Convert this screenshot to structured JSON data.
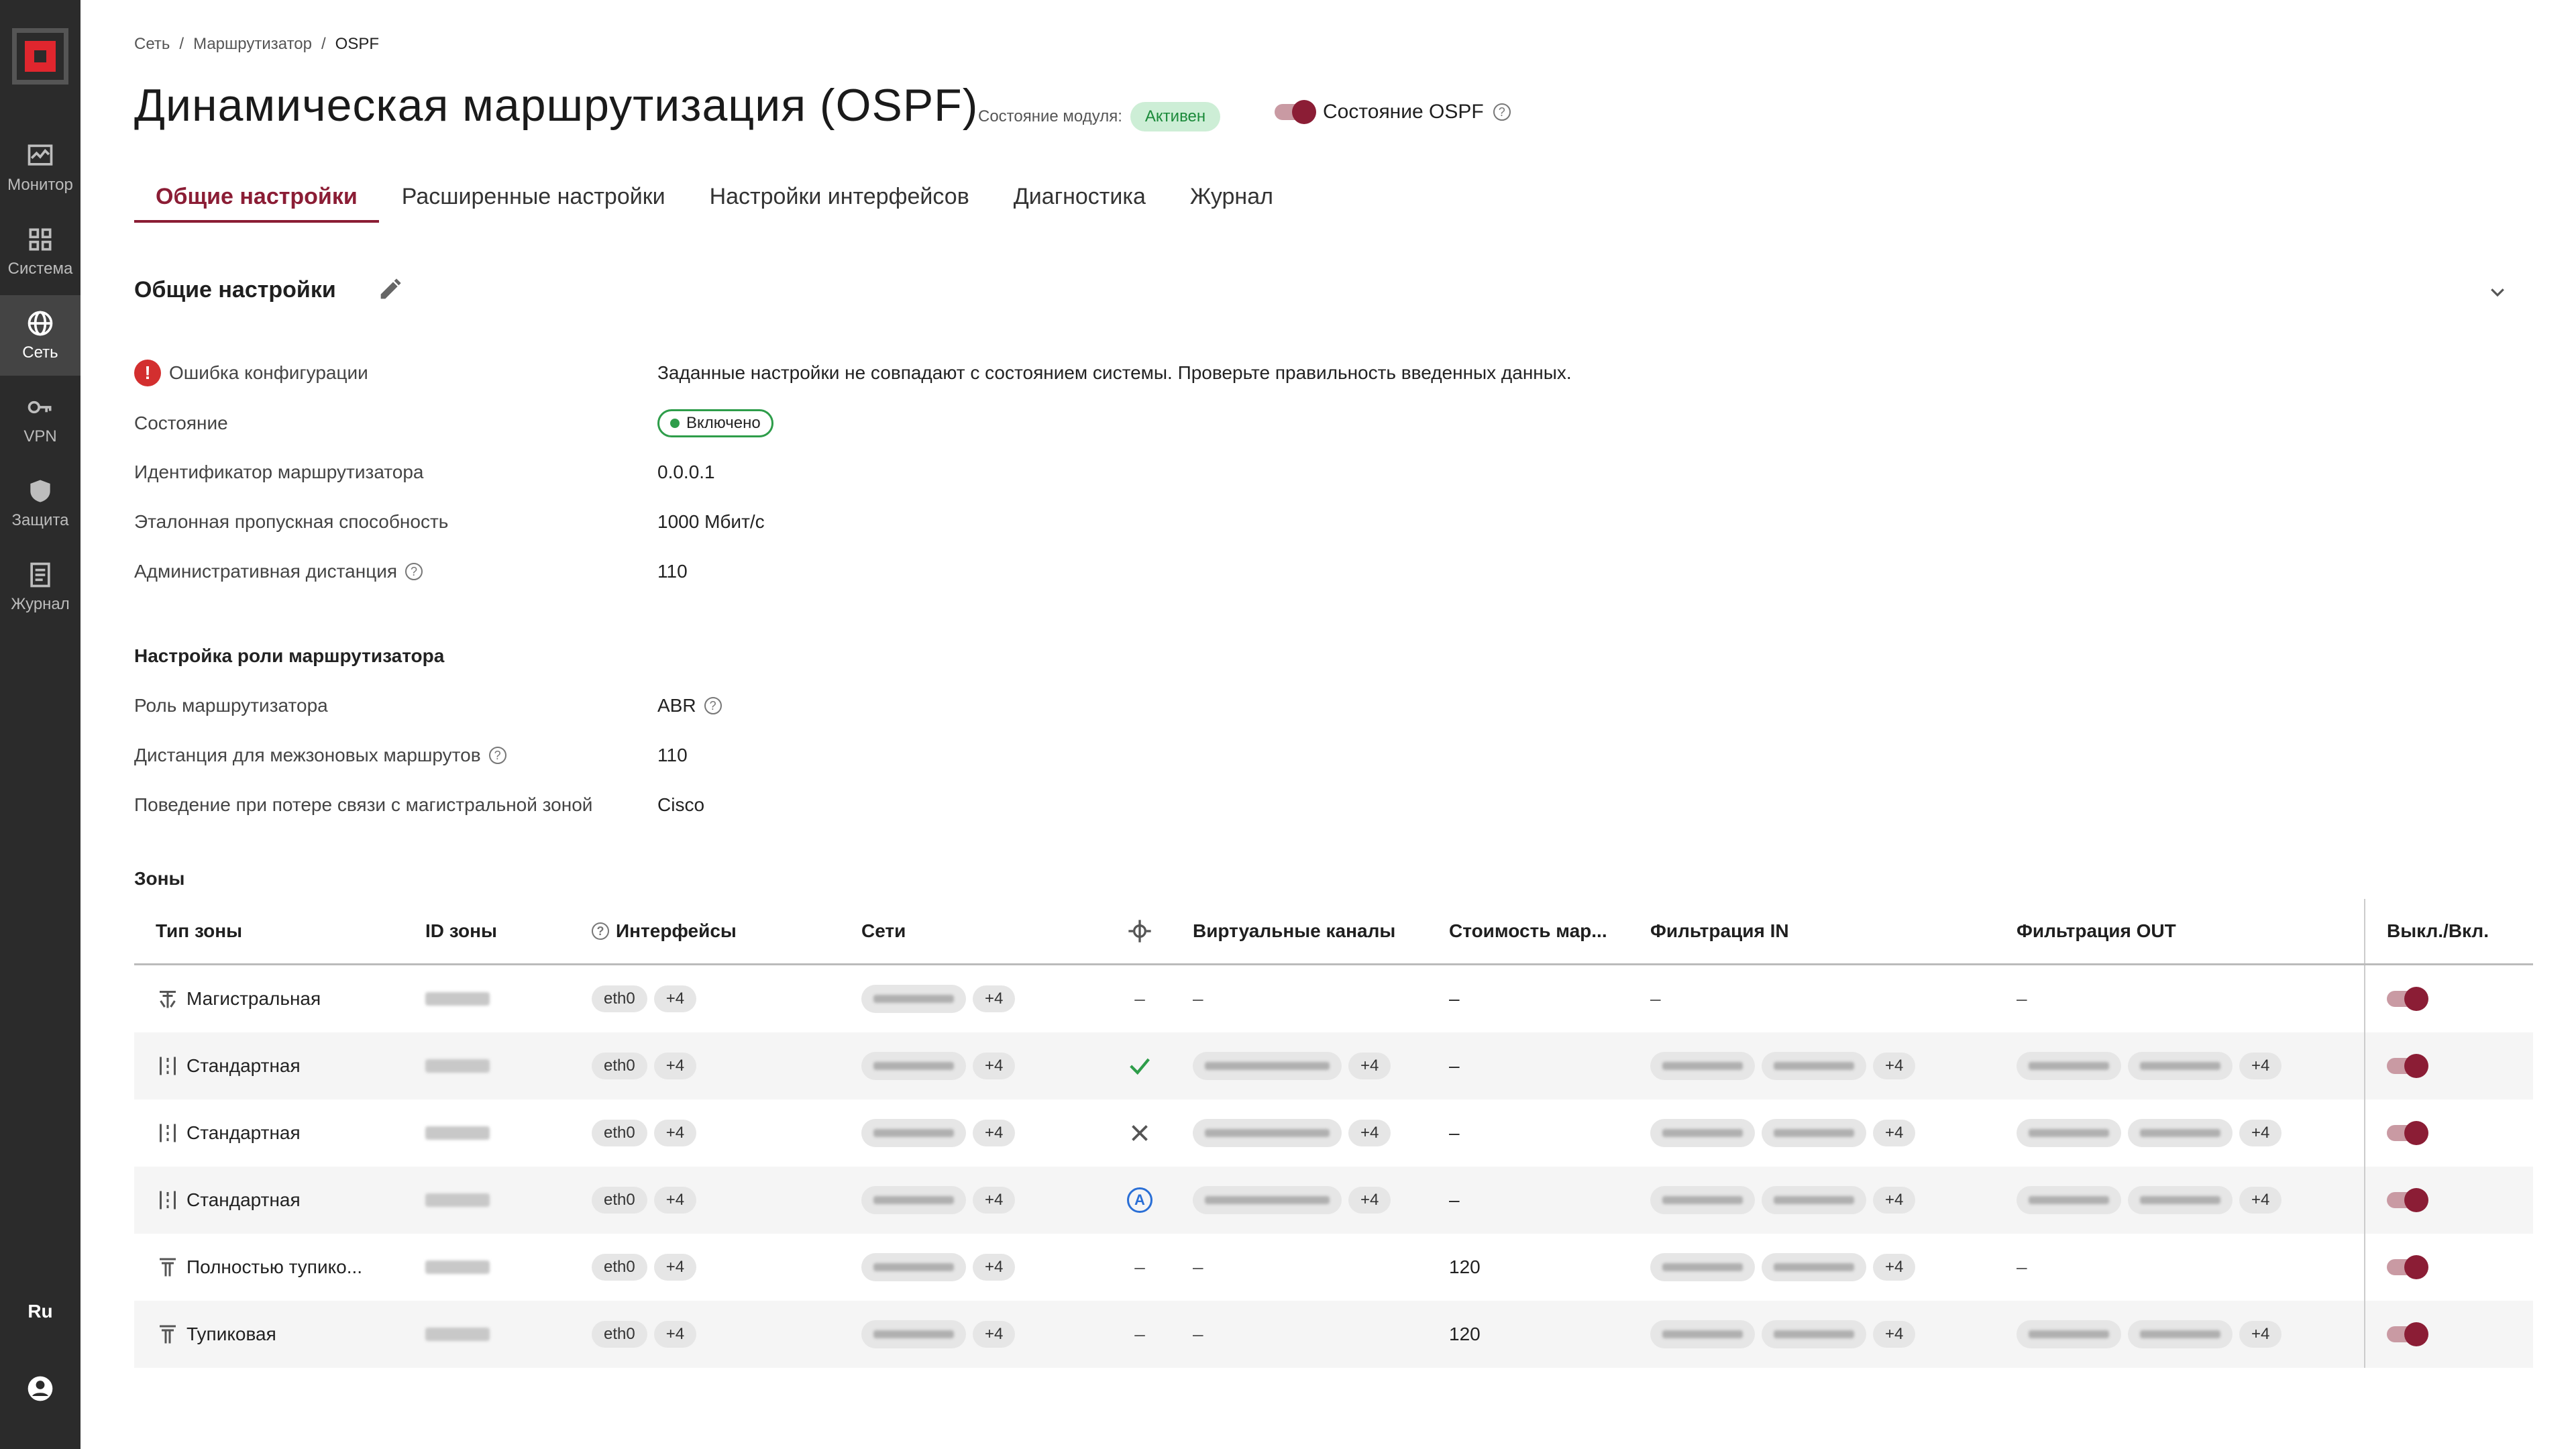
{
  "sidebar": {
    "items": [
      {
        "label": "Монитор",
        "icon": "monitor-icon"
      },
      {
        "label": "Система",
        "icon": "grid-icon"
      },
      {
        "label": "Сеть",
        "icon": "globe-icon",
        "active": true
      },
      {
        "label": "VPN",
        "icon": "key-icon"
      },
      {
        "label": "Защита",
        "icon": "shield-icon"
      },
      {
        "label": "Журнал",
        "icon": "journal-icon"
      }
    ],
    "lang": "Ru"
  },
  "breadcrumb": {
    "items": [
      "Сеть",
      "Маршрутизатор",
      "OSPF"
    ]
  },
  "page": {
    "title": "Динамическая маршрутизация (OSPF)",
    "module_state_label": "Состояние модуля:",
    "module_state_value": "Активен",
    "ospf_state_label": "Состояние OSPF"
  },
  "tabs": [
    {
      "label": "Общие настройки",
      "active": true
    },
    {
      "label": "Расширенные настройки"
    },
    {
      "label": "Настройки интерфейсов"
    },
    {
      "label": "Диагностика"
    },
    {
      "label": "Журнал"
    }
  ],
  "general": {
    "title": "Общие настройки",
    "error_label": "Ошибка конфигурации",
    "error_text": "Заданные настройки не совпадают с состоянием системы. Проверьте правильность введенных данных.",
    "state_label": "Состояние",
    "state_value": "Включено",
    "router_id_label": "Идентификатор маршрутизатора",
    "router_id_value": "0.0.0.1",
    "bandwidth_label": "Эталонная пропускная способность",
    "bandwidth_value": "1000 Мбит/с",
    "admin_distance_label": "Административная дистанция",
    "admin_distance_value": "110"
  },
  "role": {
    "title": "Настройка роли маршрутизатора",
    "role_label": "Роль маршрутизатора",
    "role_value": "ABR",
    "inter_distance_label": "Дистанция для межзоновых маршрутов",
    "inter_distance_value": "110",
    "behavior_label": "Поведение при потере связи с магистральной зоной",
    "behavior_value": "Cisco"
  },
  "zones": {
    "title": "Зоны",
    "columns": [
      "Тип зоны",
      "ID зоны",
      "Интерфейсы",
      "Сети",
      "",
      "Виртуальные каналы",
      "Стоимость мар...",
      "Фильтрация IN",
      "Фильтрация OUT",
      "Выкл./Вкл."
    ],
    "rows": [
      {
        "type": "Магистральная",
        "icon": "backbone-icon",
        "iface": "eth0",
        "more": "+4",
        "nets_more": "+4",
        "flag": "dash",
        "vlinks": "–",
        "vlinks_more": "",
        "cost": "–",
        "fin": "–",
        "fin_more": "",
        "fout": "–",
        "fout_more": ""
      },
      {
        "type": "Стандартная",
        "icon": "standard-zone-icon",
        "iface": "eth0",
        "more": "+4",
        "nets_more": "+4",
        "flag": "check",
        "vlinks": "",
        "vlinks_more": "+4",
        "cost": "–",
        "fin": "",
        "fin_more": "+4",
        "fout": "",
        "fout_more": "+4"
      },
      {
        "type": "Стандартная",
        "icon": "standard-zone-icon",
        "iface": "eth0",
        "more": "+4",
        "nets_more": "+4",
        "flag": "cross",
        "vlinks": "",
        "vlinks_more": "+4",
        "cost": "–",
        "fin": "",
        "fin_more": "+4",
        "fout": "",
        "fout_more": "+4"
      },
      {
        "type": "Стандартная",
        "icon": "standard-zone-icon",
        "iface": "eth0",
        "more": "+4",
        "nets_more": "+4",
        "flag": "auto",
        "vlinks": "",
        "vlinks_more": "+4",
        "cost": "–",
        "fin": "",
        "fin_more": "+4",
        "fout": "",
        "fout_more": "+4"
      },
      {
        "type": "Полностью тупико...",
        "icon": "stub-zone-icon",
        "iface": "eth0",
        "more": "+4",
        "nets_more": "+4",
        "flag": "dash",
        "vlinks": "–",
        "vlinks_more": "",
        "cost": "120",
        "fin": "",
        "fin_more": "+4",
        "fout": "–",
        "fout_more": ""
      },
      {
        "type": "Тупиковая",
        "icon": "stub-zone-icon",
        "iface": "eth0",
        "more": "+4",
        "nets_more": "+4",
        "flag": "dash",
        "vlinks": "–",
        "vlinks_more": "",
        "cost": "120",
        "fin": "",
        "fin_more": "+4",
        "fout": "",
        "fout_more": "+4"
      }
    ]
  },
  "flags": {
    "dash": "–",
    "auto": "A"
  }
}
